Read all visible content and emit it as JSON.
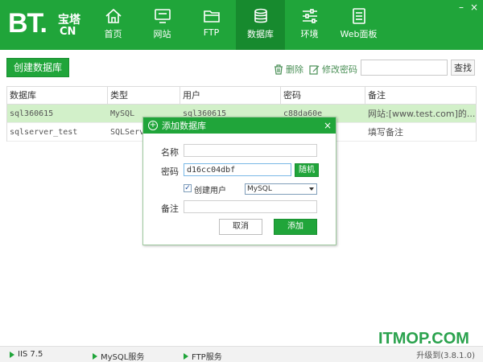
{
  "app": {
    "logo_bt": "BT.",
    "logo_cn_top": "宝塔",
    "logo_cn_bottom": "CN",
    "window_buttons": [
      "–",
      "×"
    ]
  },
  "nav": [
    {
      "label": "首页",
      "icon": "home-icon"
    },
    {
      "label": "网站",
      "icon": "monitor-icon"
    },
    {
      "label": "FTP",
      "icon": "folder-icon"
    },
    {
      "label": "数据库",
      "icon": "database-icon",
      "active": true
    },
    {
      "label": "环境",
      "icon": "sliders-icon"
    },
    {
      "label": "Web面板",
      "icon": "document-icon"
    }
  ],
  "toolbar": {
    "create_label": "创建数据库",
    "delete_label": "删除",
    "change_password_label": "修改密码",
    "search_value": "",
    "search_button": "查找"
  },
  "table": {
    "headers": [
      "数据库",
      "类型",
      "用户",
      "密码",
      "备注"
    ],
    "rows": [
      {
        "name": "sql360615",
        "type": "MySQL",
        "user": "sql360615",
        "password": "c88da60e",
        "note": "网站:[www.test.com]的..."
      },
      {
        "name": "sqlserver_test",
        "type": "SQLServer",
        "user": "",
        "password": "",
        "note": "填写备注"
      }
    ]
  },
  "dialog": {
    "title": "添加数据库",
    "close": "×",
    "name_label": "名称",
    "name_value": "",
    "password_label": "密码",
    "password_value": "d16cc04dbf",
    "random_button": "随机",
    "create_user_checked": true,
    "create_user_label": "创建用户",
    "db_type_selected": "MySQL",
    "note_label": "备注",
    "note_value": "",
    "cancel_button": "取消",
    "add_button": "添加"
  },
  "status": {
    "services": [
      "IIS 7.5",
      "MySQL服务",
      "FTP服务"
    ],
    "upgrade": "升级到(3.8.1.0)"
  },
  "watermark": "ITMOP.COM",
  "colors": {
    "brand_green": "#20a53a",
    "active_nav": "#178a2e",
    "selected_row": "#d2f0c9"
  }
}
